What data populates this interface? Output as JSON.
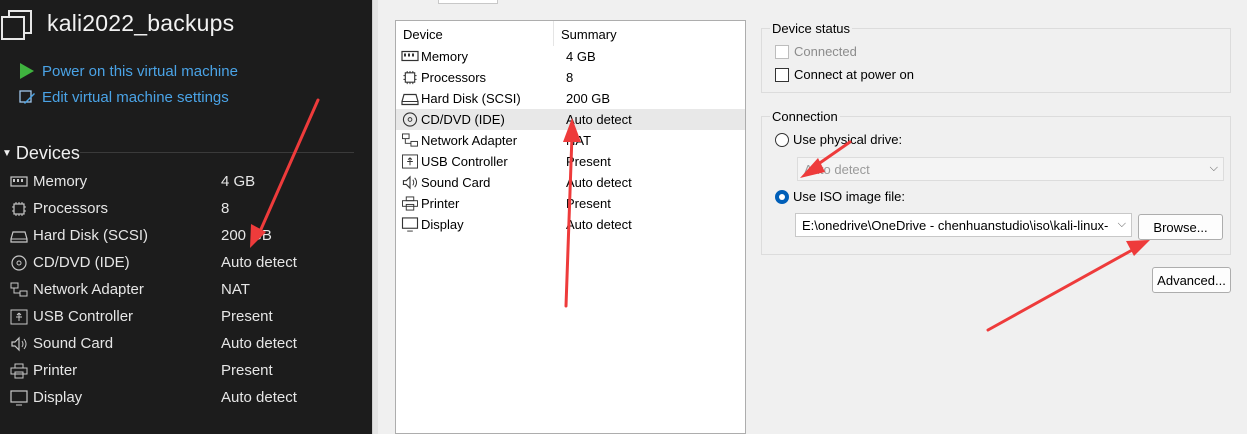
{
  "vm": {
    "title": "kali2022_backups"
  },
  "actions": {
    "power_on": "Power on this virtual machine",
    "edit_settings": "Edit virtual machine settings"
  },
  "devices_heading": "Devices",
  "devices": [
    {
      "icon": "memory-icon",
      "name": "Memory",
      "value": "4 GB"
    },
    {
      "icon": "processor-icon",
      "name": "Processors",
      "value": "8"
    },
    {
      "icon": "hard-disk-icon",
      "name": "Hard Disk (SCSI)",
      "value": "200 GB"
    },
    {
      "icon": "cd-dvd-icon",
      "name": "CD/DVD (IDE)",
      "value": "Auto detect"
    },
    {
      "icon": "network-adapter-icon",
      "name": "Network Adapter",
      "value": "NAT"
    },
    {
      "icon": "usb-icon",
      "name": "USB Controller",
      "value": "Present"
    },
    {
      "icon": "sound-card-icon",
      "name": "Sound Card",
      "value": "Auto detect"
    },
    {
      "icon": "printer-icon",
      "name": "Printer",
      "value": "Present"
    },
    {
      "icon": "display-icon",
      "name": "Display",
      "value": "Auto detect"
    }
  ],
  "device_list": {
    "col_device": "Device",
    "col_summary": "Summary",
    "selected_index": 3
  },
  "device_status": {
    "title": "Device status",
    "connected": "Connected",
    "connect_at_power_on": "Connect at power on"
  },
  "connection": {
    "title": "Connection",
    "use_physical_drive": "Use physical drive:",
    "physical_drive_value": "Auto detect",
    "use_iso": "Use ISO image file:",
    "iso_path": "E:\\onedrive\\OneDrive - chenhuanstudio\\iso\\kali-linux-",
    "browse": "Browse...",
    "advanced": "Advanced..."
  },
  "colors": {
    "accent": "#005fb8",
    "link": "#4aa3e6",
    "arrow": "#ee3b3b"
  }
}
